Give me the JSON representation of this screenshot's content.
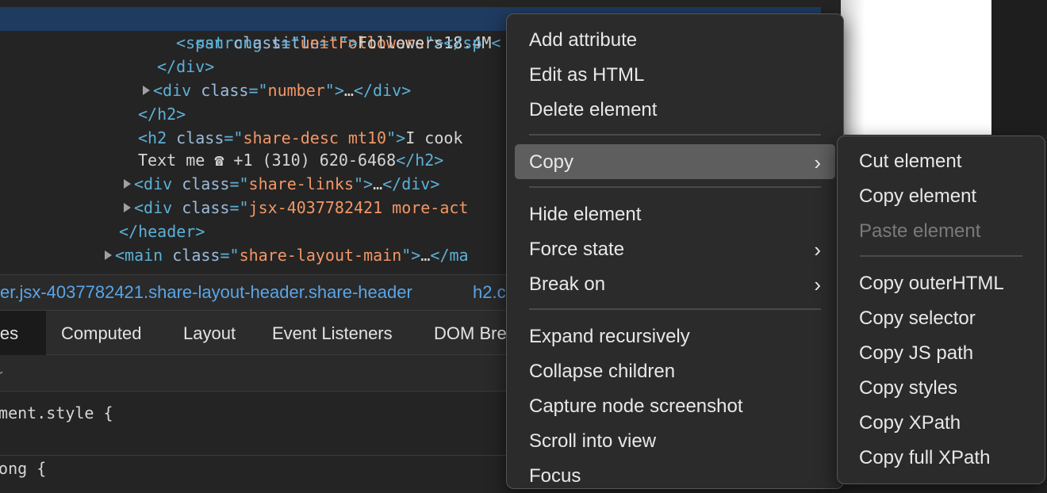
{
  "elements_panel": {
    "lines": [
      {
        "indent": 0,
        "html": [
          [
            "tag",
            "  "
          ],
          [
            "tag",
            "<strong "
          ],
          [
            "attr",
            "title"
          ],
          [
            "tag",
            "=\""
          ],
          [
            "val",
            "Followers"
          ],
          [
            "tag",
            "\">"
          ],
          [
            "txt",
            "18.4M"
          ],
          [
            "tag",
            "<"
          ]
        ],
        "selected": true
      },
      {
        "html": [
          [
            "tag",
            "<span "
          ],
          [
            "attr",
            "class"
          ],
          [
            "tag",
            "=\""
          ],
          [
            "val",
            "unit"
          ],
          [
            "tag",
            "\">"
          ],
          [
            "txt",
            "Followers"
          ],
          [
            "tag",
            "</sp"
          ]
        ]
      },
      {
        "html": [
          [
            "tag",
            "</div>"
          ]
        ]
      },
      {
        "html": [
          [
            "tag",
            "<div "
          ],
          [
            "attr",
            "class"
          ],
          [
            "tag",
            "=\""
          ],
          [
            "val",
            "number"
          ],
          [
            "tag",
            "\">"
          ],
          [
            "txt",
            "…"
          ],
          [
            "tag",
            "</div>"
          ]
        ]
      },
      {
        "html": [
          [
            "tag",
            "</h2>"
          ]
        ]
      },
      {
        "html": [
          [
            "tag",
            "<h2 "
          ],
          [
            "attr",
            "class"
          ],
          [
            "tag",
            "=\""
          ],
          [
            "val",
            "share-desc mt10"
          ],
          [
            "tag",
            "\">"
          ],
          [
            "txt",
            "I cook"
          ]
        ]
      },
      {
        "html": [
          [
            "txt",
            "Text me ☎ +1 (310) 620-6468"
          ],
          [
            "tag",
            "</h2>"
          ]
        ]
      },
      {
        "html": [
          [
            "tag",
            "<div "
          ],
          [
            "attr",
            "class"
          ],
          [
            "tag",
            "=\""
          ],
          [
            "val",
            "share-links"
          ],
          [
            "tag",
            "\">"
          ],
          [
            "txt",
            "…"
          ],
          [
            "tag",
            "</div>"
          ]
        ]
      },
      {
        "html": [
          [
            "tag",
            "<div "
          ],
          [
            "attr",
            "class"
          ],
          [
            "tag",
            "=\""
          ],
          [
            "val",
            "jsx-4037782421 more-act"
          ]
        ]
      },
      {
        "html": [
          [
            "tag",
            "</header>"
          ]
        ]
      },
      {
        "html": [
          [
            "tag",
            "<main "
          ],
          [
            "attr",
            "class"
          ],
          [
            "tag",
            "=\""
          ],
          [
            "val",
            "share-layout-main"
          ],
          [
            "tag",
            "\">"
          ],
          [
            "txt",
            "…"
          ],
          [
            "tag",
            "</ma"
          ]
        ]
      }
    ]
  },
  "breadcrumb": {
    "item1": "er.jsx-4037782421.share-layout-header.share-header",
    "item2": "h2.c"
  },
  "tabs": {
    "styles": "yles",
    "computed": "Computed",
    "layout": "Layout",
    "event_listeners": "Event Listeners",
    "dom_breakpoints": "DOM Bre"
  },
  "filter": {
    "placeholder": "er"
  },
  "styles_pane": {
    "rule1": "ement.style {",
    "rule2": "rong {"
  },
  "context_menu": {
    "add_attribute": "Add attribute",
    "edit_as_html": "Edit as HTML",
    "delete_element": "Delete element",
    "copy": "Copy",
    "hide_element": "Hide element",
    "force_state": "Force state",
    "break_on": "Break on",
    "expand_recursively": "Expand recursively",
    "collapse_children": "Collapse children",
    "capture_node_screenshot": "Capture node screenshot",
    "scroll_into_view": "Scroll into view",
    "focus": "Focus",
    "chevron": "›"
  },
  "copy_submenu": {
    "cut_element": "Cut element",
    "copy_element": "Copy element",
    "paste_element": "Paste element",
    "copy_outerhtml": "Copy outerHTML",
    "copy_selector": "Copy selector",
    "copy_js_path": "Copy JS path",
    "copy_styles": "Copy styles",
    "copy_xpath": "Copy XPath",
    "copy_full_xpath": "Copy full XPath"
  },
  "colors": {
    "selection": "#1f3b60",
    "tag": "#5db0d7",
    "attr": "#9bbbdc",
    "value": "#f29766",
    "menu_highlight": "#5e5e5e"
  }
}
